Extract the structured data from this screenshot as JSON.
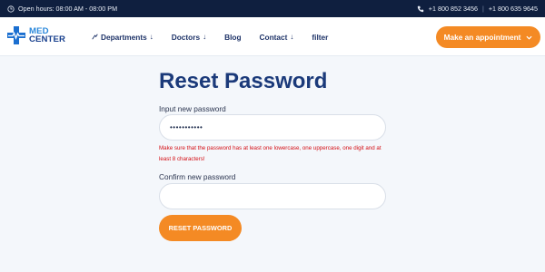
{
  "topbar": {
    "hours": "Open hours: 08:00 AM - 08:00 PM",
    "phone1": "+1 800 852 3456",
    "phone2": "+1 800 635 9645",
    "separator": "|"
  },
  "header": {
    "logo": {
      "line1": "MED",
      "line2": "CENTER"
    },
    "nav": [
      {
        "label": "Departments",
        "has_dropdown": true
      },
      {
        "label": "Doctors",
        "has_dropdown": true
      },
      {
        "label": "Blog",
        "has_dropdown": false
      },
      {
        "label": "Contact",
        "has_dropdown": true
      },
      {
        "label": "filter",
        "has_dropdown": false
      }
    ],
    "appointment_button": "Make an appointment"
  },
  "form": {
    "title": "Reset Password",
    "new_password_label": "Input new password",
    "new_password_value": "•••••••••••",
    "error_message": "Make sure that the password has at least one lowercase, one uppercase, one digit and at least 8 characters!",
    "confirm_label": "Confirm new password",
    "confirm_value": "",
    "submit_label": "RESET PASSWORD"
  },
  "colors": {
    "topbar_bg": "#0f1f3f",
    "accent": "#f48a24",
    "title": "#1b3a7a",
    "error": "#d40e14"
  }
}
